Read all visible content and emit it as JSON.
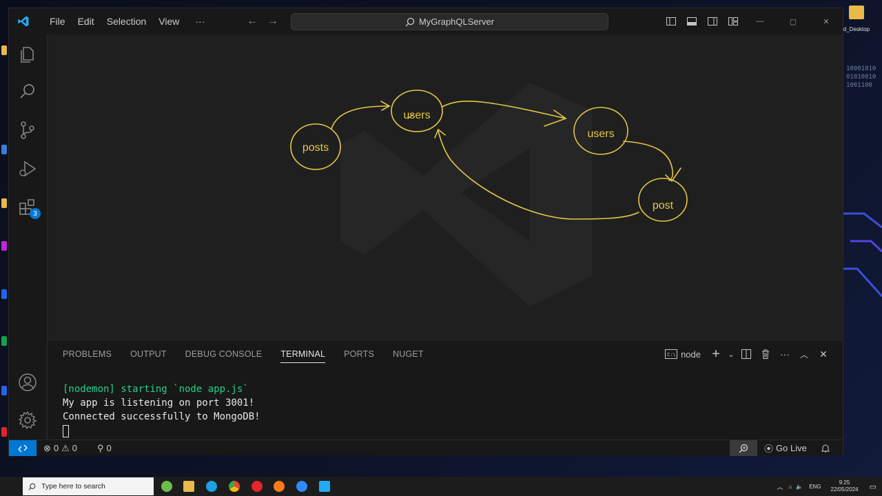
{
  "window": {
    "menu": [
      "File",
      "Edit",
      "Selection",
      "View",
      "···"
    ],
    "search_text": "MyGraphQLServer"
  },
  "activity_bar": {
    "extensions_badge": "3"
  },
  "diagram": {
    "nodes": [
      {
        "id": "posts",
        "label": "posts"
      },
      {
        "id": "users1",
        "label": "users"
      },
      {
        "id": "users2",
        "label": "users"
      },
      {
        "id": "post",
        "label": "post"
      }
    ],
    "stroke_color": "#e6c845"
  },
  "panel": {
    "tabs": [
      "PROBLEMS",
      "OUTPUT",
      "DEBUG CONSOLE",
      "TERMINAL",
      "PORTS",
      "NUGET"
    ],
    "active_tab": "TERMINAL",
    "terminal_name": "node",
    "lines": [
      "[nodemon] starting `node app.js`",
      "My app is listening on port 3001!",
      "Connected successfully to MongoDB!"
    ]
  },
  "statusbar": {
    "errors": "0",
    "warnings": "0",
    "ports": "0",
    "go_live": "Go Live"
  },
  "desktop": {
    "folder_label": "ld_Desktop",
    "binary": [
      "10001010",
      "01010010",
      "1001100"
    ]
  },
  "taskbar": {
    "search_placeholder": "Type here to search",
    "lang": "ENG",
    "time": "9:25",
    "date": "22/05/2024"
  }
}
